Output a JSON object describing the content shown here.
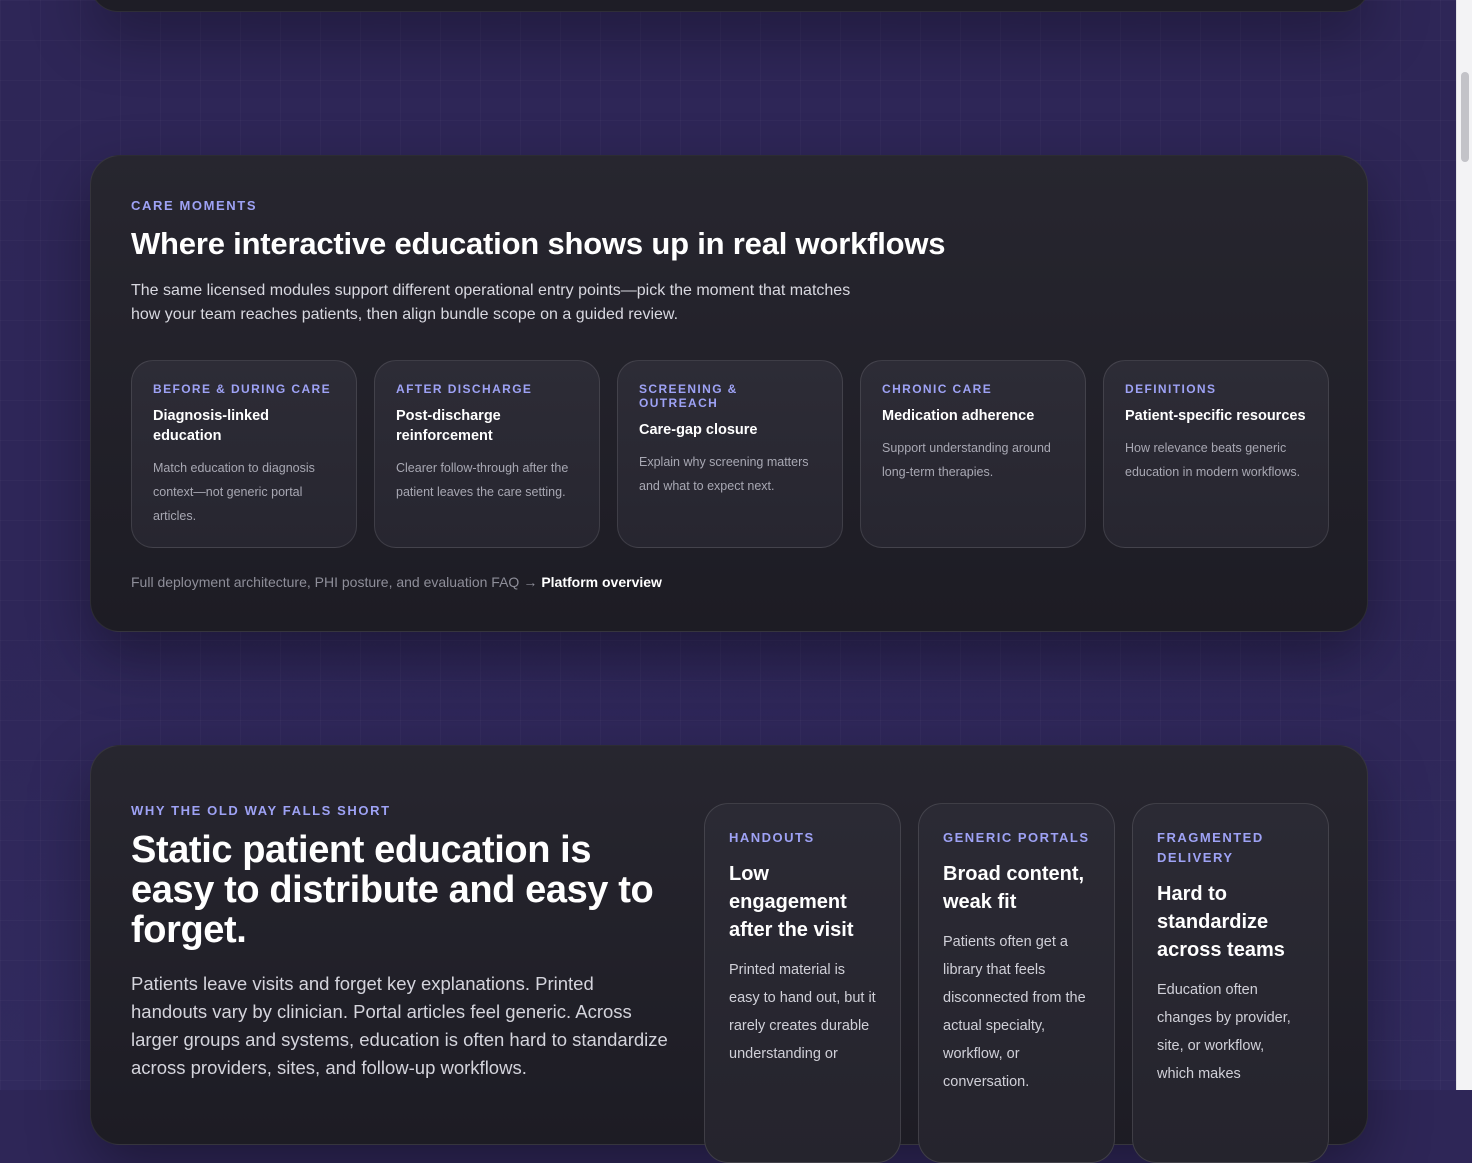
{
  "care_moments": {
    "eyebrow": "CARE MOMENTS",
    "title": "Where interactive education shows up in real workflows",
    "description": "The same licensed modules support different operational entry points—pick the moment that matches how your team reaches patients, then align bundle scope on a guided review.",
    "cards": [
      {
        "eyebrow": "BEFORE & DURING CARE",
        "title": "Diagnosis-linked education",
        "body": "Match education to diagnosis context—not generic portal articles."
      },
      {
        "eyebrow": "AFTER DISCHARGE",
        "title": "Post-discharge reinforcement",
        "body": "Clearer follow-through after the patient leaves the care setting."
      },
      {
        "eyebrow": "SCREENING & OUTREACH",
        "title": "Care-gap closure",
        "body": "Explain why screening matters and what to expect next."
      },
      {
        "eyebrow": "CHRONIC CARE",
        "title": "Medication adherence",
        "body": "Support understanding around long-term therapies."
      },
      {
        "eyebrow": "DEFINITIONS",
        "title": "Patient-specific resources",
        "body": "How relevance beats generic education in modern workflows."
      }
    ],
    "footer_text": "Full deployment architecture, PHI posture, and evaluation FAQ",
    "footer_arrow": "→",
    "footer_link": "Platform overview"
  },
  "old_way": {
    "eyebrow": "WHY THE OLD WAY FALLS SHORT",
    "title": "Static patient education is easy to distribute and easy to forget.",
    "description": "Patients leave visits and forget key explanations. Printed handouts vary by clinician. Portal articles feel generic. Across larger groups and systems, education is often hard to standardize across providers, sites, and follow-up workflows.",
    "cards": [
      {
        "eyebrow": "HANDOUTS",
        "title": "Low engagement after the visit",
        "body": "Printed material is easy to hand out, but it rarely creates durable understanding or"
      },
      {
        "eyebrow": "GENERIC PORTALS",
        "title": "Broad content, weak fit",
        "body": "Patients often get a library that feels disconnected from the actual specialty, workflow, or conversation."
      },
      {
        "eyebrow": "FRAGMENTED DELIVERY",
        "title": "Hard to standardize across teams",
        "body": "Education often changes by provider, site, or workflow, which makes"
      }
    ]
  },
  "colors": {
    "background": "#2e2657",
    "panel": "#23222b",
    "eyebrow_accent": "#9ea2f5"
  }
}
